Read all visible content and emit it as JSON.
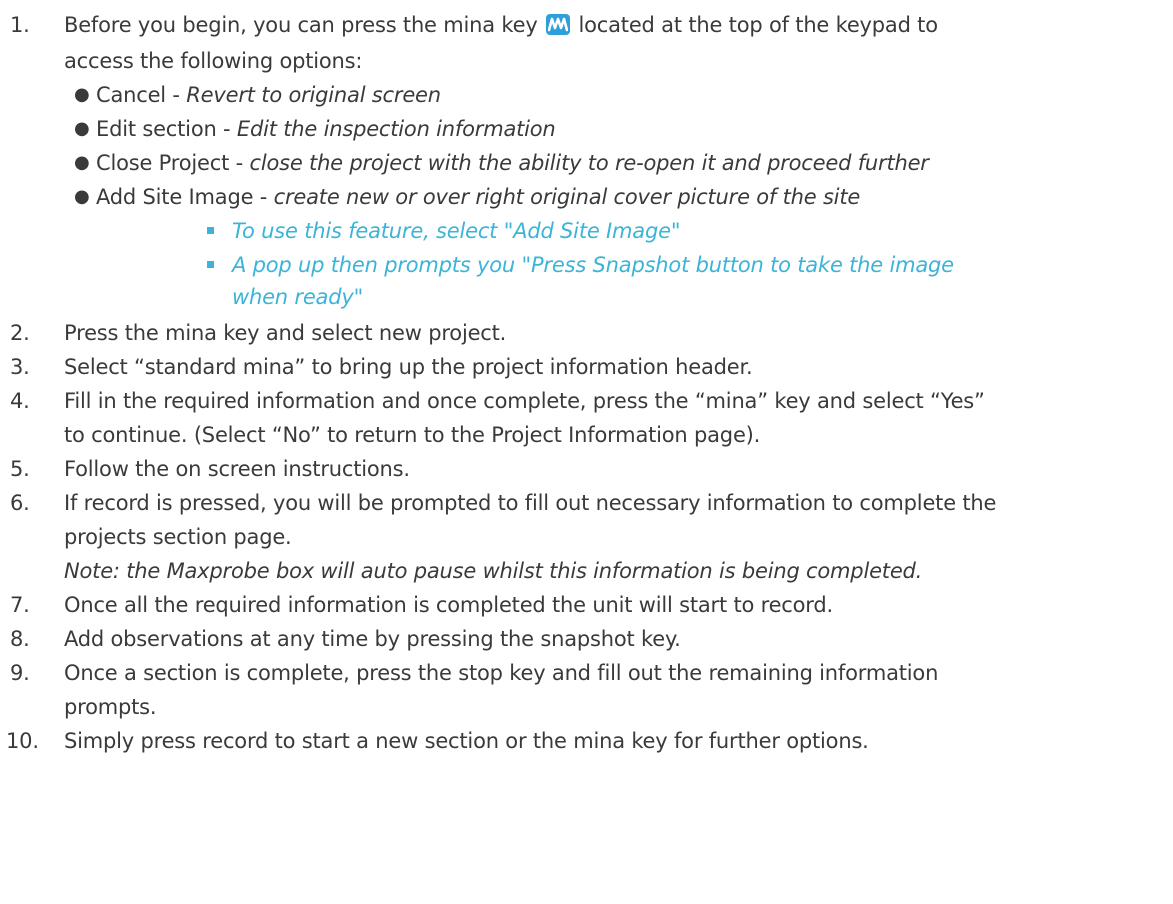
{
  "accent_color": "#3bb4d8",
  "icon_color": "#2e9fd8",
  "icons": {
    "mina_key": "mina-key-icon"
  },
  "steps": [
    {
      "number": "1.",
      "text_before_icon": "Before you begin, you can press the mina key ",
      "text_after_icon": " located at the top of the keypad to",
      "continuation": "access the following options:",
      "options": [
        {
          "label": "Cancel - ",
          "description": "Revert to original screen"
        },
        {
          "label": "Edit section - ",
          "description": "Edit the inspection information"
        },
        {
          "label": "Close Project - ",
          "description": "close the project with the ability to re-open it and proceed further"
        },
        {
          "label": "Add Site Image - ",
          "description": "create new or over right original cover picture of the site"
        }
      ],
      "sub_steps": [
        "To use this feature, select \"Add Site Image\"",
        "A pop up then prompts you \"Press Snapshot button to take the image",
        "when ready\""
      ]
    },
    {
      "number": "2.",
      "text": "Press the mina key and select new project."
    },
    {
      "number": "3.",
      "text": "Select “standard mina” to bring up the project information header."
    },
    {
      "number": "4.",
      "text": "Fill in the required information and once complete, press the “mina” key and select “Yes”",
      "continuation": "to continue. (Select “No” to return to the Project Information page)."
    },
    {
      "number": "5.",
      "text": "Follow the on screen instructions."
    },
    {
      "number": "6.",
      "text": "If record is pressed, you will be prompted to fill out necessary information to complete the",
      "continuation": "projects section page.",
      "note": "Note: the Maxprobe box will auto pause whilst this information is being completed."
    },
    {
      "number": "7.",
      "text": "Once all the required information is completed the unit will start to record."
    },
    {
      "number": "8.",
      "text": "Add observations at any time by pressing the snapshot key."
    },
    {
      "number": "9.",
      "text": "Once a section is complete, press the stop key and fill out the remaining information",
      "continuation": "prompts."
    },
    {
      "number": "10.",
      "text": "Simply press record to start a new section or the mina key for further options."
    }
  ]
}
